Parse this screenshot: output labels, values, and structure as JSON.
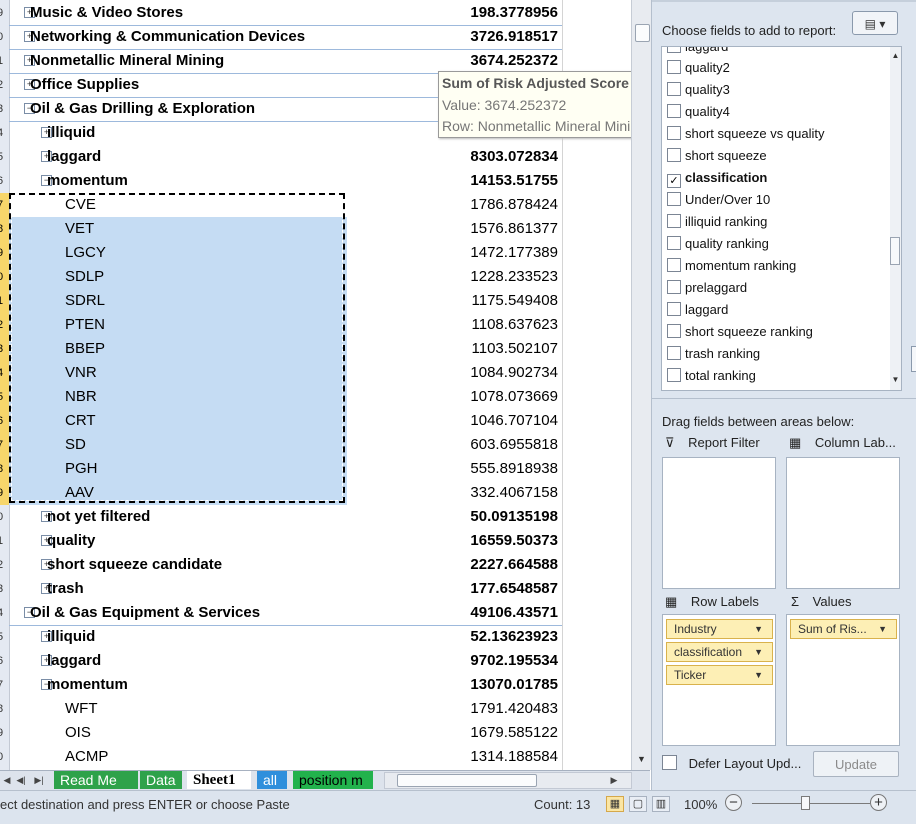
{
  "grid": {
    "rows": [
      {
        "num": "9",
        "label": "Music & Video Stores",
        "value": "198.3778956",
        "level": 0,
        "toggle": "⊞",
        "bold": true
      },
      {
        "num": "0",
        "label": "Networking & Communication Devices",
        "value": "3726.918517",
        "level": 0,
        "toggle": "⊞",
        "bold": true
      },
      {
        "num": "1",
        "label": "Nonmetallic Mineral Mining",
        "value": "3674.252372",
        "level": 0,
        "toggle": "⊞",
        "bold": true
      },
      {
        "num": "2",
        "label": "Office Supplies",
        "value": "",
        "level": 0,
        "toggle": "⊞",
        "bold": true
      },
      {
        "num": "3",
        "label": "Oil & Gas Drilling & Exploration",
        "value": "",
        "level": 0,
        "toggle": "⊟",
        "bold": true
      },
      {
        "num": "4",
        "label": "illiquid",
        "value": "",
        "level": 1,
        "toggle": "⊞",
        "bold": true
      },
      {
        "num": "5",
        "label": "laggard",
        "value": "8303.072834",
        "level": 1,
        "toggle": "⊞",
        "bold": true
      },
      {
        "num": "6",
        "label": "momentum",
        "value": "14153.51755",
        "level": 1,
        "toggle": "⊟",
        "bold": true
      },
      {
        "num": "7",
        "label": "CVE",
        "value": "1786.878424",
        "level": 2,
        "toggle": "",
        "bold": false
      },
      {
        "num": "8",
        "label": "VET",
        "value": "1576.861377",
        "level": 2,
        "toggle": "",
        "bold": false
      },
      {
        "num": "9",
        "label": "LGCY",
        "value": "1472.177389",
        "level": 2,
        "toggle": "",
        "bold": false
      },
      {
        "num": "0",
        "label": "SDLP",
        "value": "1228.233523",
        "level": 2,
        "toggle": "",
        "bold": false
      },
      {
        "num": "1",
        "label": "SDRL",
        "value": "1175.549408",
        "level": 2,
        "toggle": "",
        "bold": false
      },
      {
        "num": "2",
        "label": "PTEN",
        "value": "1108.637623",
        "level": 2,
        "toggle": "",
        "bold": false
      },
      {
        "num": "3",
        "label": "BBEP",
        "value": "1103.502107",
        "level": 2,
        "toggle": "",
        "bold": false
      },
      {
        "num": "4",
        "label": "VNR",
        "value": "1084.902734",
        "level": 2,
        "toggle": "",
        "bold": false
      },
      {
        "num": "5",
        "label": "NBR",
        "value": "1078.073669",
        "level": 2,
        "toggle": "",
        "bold": false
      },
      {
        "num": "6",
        "label": "CRT",
        "value": "1046.707104",
        "level": 2,
        "toggle": "",
        "bold": false
      },
      {
        "num": "7",
        "label": "SD",
        "value": "603.6955818",
        "level": 2,
        "toggle": "",
        "bold": false
      },
      {
        "num": "8",
        "label": "PGH",
        "value": "555.8918938",
        "level": 2,
        "toggle": "",
        "bold": false
      },
      {
        "num": "9",
        "label": "AAV",
        "value": "332.4067158",
        "level": 2,
        "toggle": "",
        "bold": false
      },
      {
        "num": "0",
        "label": "not yet filtered",
        "value": "50.09135198",
        "level": 1,
        "toggle": "⊞",
        "bold": true
      },
      {
        "num": "1",
        "label": "quality",
        "value": "16559.50373",
        "level": 1,
        "toggle": "⊞",
        "bold": true
      },
      {
        "num": "2",
        "label": "short squeeze candidate",
        "value": "2227.664588",
        "level": 1,
        "toggle": "⊞",
        "bold": true
      },
      {
        "num": "3",
        "label": "trash",
        "value": "177.6548587",
        "level": 1,
        "toggle": "⊞",
        "bold": true
      },
      {
        "num": "4",
        "label": "Oil & Gas Equipment & Services",
        "value": "49106.43571",
        "level": 0,
        "toggle": "⊟",
        "bold": true
      },
      {
        "num": "5",
        "label": "illiquid",
        "value": "52.13623923",
        "level": 1,
        "toggle": "⊞",
        "bold": true
      },
      {
        "num": "6",
        "label": "laggard",
        "value": "9702.195534",
        "level": 1,
        "toggle": "⊞",
        "bold": true
      },
      {
        "num": "7",
        "label": "momentum",
        "value": "13070.01785",
        "level": 1,
        "toggle": "⊟",
        "bold": true
      },
      {
        "num": "8",
        "label": "WFT",
        "value": "1791.420483",
        "level": 2,
        "toggle": "",
        "bold": false
      },
      {
        "num": "9",
        "label": "OIS",
        "value": "1679.585122",
        "level": 2,
        "toggle": "",
        "bold": false
      },
      {
        "num": "0",
        "label": "ACMP",
        "value": "1314.188584",
        "level": 2,
        "toggle": "",
        "bold": false
      }
    ],
    "tooltip": {
      "title": "Sum of Risk Adjusted Score",
      "value_line": "Value: 3674.252372",
      "row_line": "Row: Nonmetallic Mineral Mining"
    }
  },
  "tabs": [
    {
      "label": "Read Me",
      "bg": "#2ea24a",
      "color": "#ffffff"
    },
    {
      "label": "Data",
      "bg": "#2ea24a",
      "color": "#ffffff"
    },
    {
      "label": "Sheet1",
      "bg": "#ffffff",
      "color": "#000000",
      "active": true
    },
    {
      "label": "all",
      "bg": "#2f8fdc",
      "color": "#ffffff"
    },
    {
      "label": "position m",
      "bg": "#22b24c",
      "color": "#000000"
    }
  ],
  "status": {
    "message": "ect destination and press ENTER or choose Paste",
    "count": "Count: 13",
    "zoom": "100%"
  },
  "panel": {
    "choose_label": "Choose fields to add to report:",
    "fields": [
      {
        "label": "laggard",
        "checked": false
      },
      {
        "label": "quality2",
        "checked": false
      },
      {
        "label": "quality3",
        "checked": false
      },
      {
        "label": "quality4",
        "checked": false
      },
      {
        "label": "short squeeze vs quality",
        "checked": false
      },
      {
        "label": "short squeeze",
        "checked": false
      },
      {
        "label": "classification",
        "checked": true
      },
      {
        "label": "Under/Over 10",
        "checked": false
      },
      {
        "label": "illiquid ranking",
        "checked": false
      },
      {
        "label": "quality ranking",
        "checked": false
      },
      {
        "label": "momentum ranking",
        "checked": false
      },
      {
        "label": "prelaggard",
        "checked": false
      },
      {
        "label": "laggard",
        "checked": false
      },
      {
        "label": "short squeeze ranking",
        "checked": false
      },
      {
        "label": "trash ranking",
        "checked": false
      },
      {
        "label": "total ranking",
        "checked": false
      }
    ],
    "drag_label": "Drag fields between areas below:",
    "report_filter": "Report Filter",
    "column_labels": "Column Lab...",
    "row_labels": "Row Labels",
    "values": "Values",
    "row_chips": [
      "Industry",
      "classification",
      "Ticker"
    ],
    "value_chips": [
      "Sum of Ris..."
    ],
    "defer_label": "Defer Layout Upd...",
    "update_label": "Update"
  }
}
